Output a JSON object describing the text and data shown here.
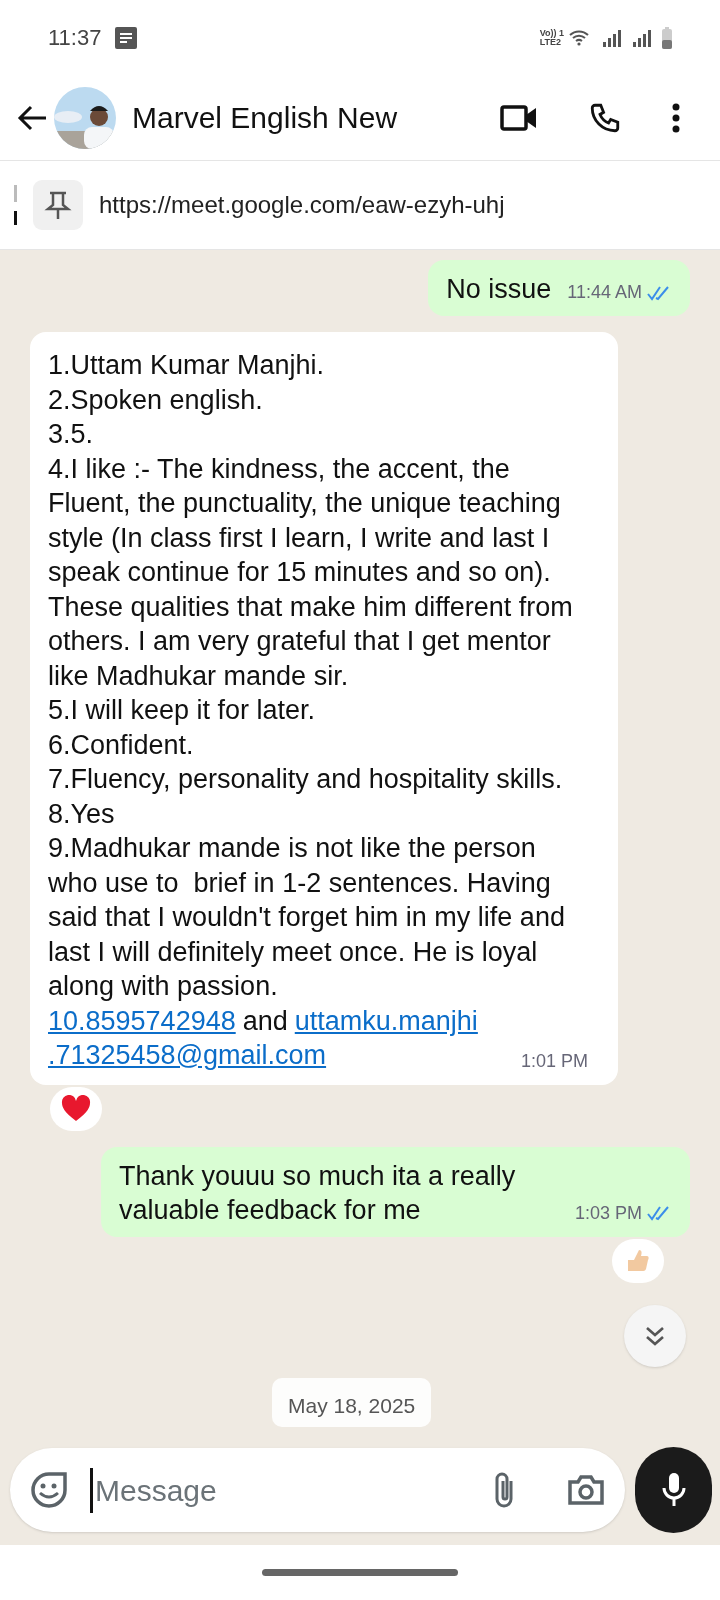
{
  "status_bar": {
    "time": "11:37",
    "network_lines": [
      "Vo)) 1",
      "LTE2"
    ]
  },
  "header": {
    "title": "Marvel English New"
  },
  "pinned": {
    "text": "https://meet.google.com/eaw-ezyh-uhj"
  },
  "messages": [
    {
      "kind": "outgoing",
      "paragraphs": [
        "No issue"
      ],
      "time": "11:44 AM",
      "read": true
    },
    {
      "kind": "incoming",
      "paragraphs": [
        "1.Uttam Kumar Manjhi.",
        "2.Spoken english.",
        "3.5.",
        "4.I like :- The kindness, the accent, the Fluent, the punctuality, the unique teaching style (In class first I learn, I write and last I speak continue for 15 minutes and so on). These qualities that make him different from others. I am very grateful that I get mentor like Madhukar mande sir.",
        "5.I will keep it for later.",
        "6.Confident.",
        "7.Fluency, personality and hospitality skills.",
        "8.Yes",
        "9.Madhukar mande is not like the person who use to  brief in 1-2 sentences. Having said that I wouldn't forget him in my life and last I will definitely meet once. He is loyal along with passion."
      ],
      "last_line": [
        {
          "kind": "link",
          "text": "10.8595742948"
        },
        {
          "kind": "text",
          "text": "and"
        },
        {
          "kind": "link",
          "text": "uttamku.manjhi"
        },
        {
          "kind": "link",
          "text": ".71325458@gmail.com"
        }
      ],
      "time": "1:01 PM",
      "reaction": {
        "kind": "heart"
      }
    },
    {
      "kind": "outgoing",
      "paragraphs": [
        "Thank youuu so much ita a really valuable feedback for me"
      ],
      "time": "1:03 PM",
      "read": true,
      "reaction": {
        "kind": "thumb"
      }
    }
  ],
  "date_chip": "May 18, 2025",
  "composer": {
    "placeholder": "Message"
  }
}
